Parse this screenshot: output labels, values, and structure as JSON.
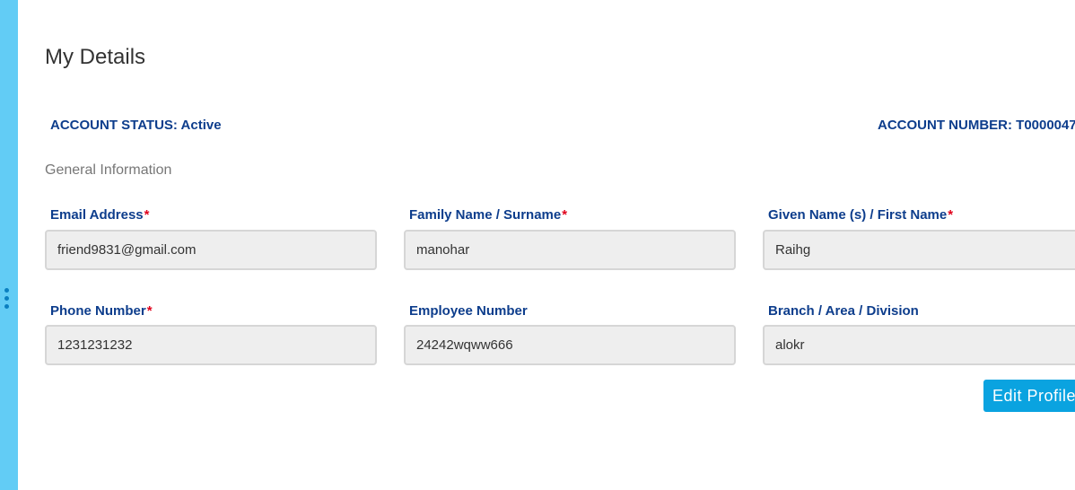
{
  "page": {
    "title": "My Details"
  },
  "account": {
    "status_label": "ACCOUNT STATUS: Active",
    "number_label": "ACCOUNT NUMBER: T0000047"
  },
  "section": {
    "title": "General Information"
  },
  "fields": {
    "email": {
      "label": "Email Address",
      "required": "*",
      "value": "friend9831@gmail.com"
    },
    "family_name": {
      "label": "Family Name / Surname",
      "required": "*",
      "value": "manohar"
    },
    "given_name": {
      "label": "Given Name (s) / First Name",
      "required": "*",
      "value": "Raihg"
    },
    "phone": {
      "label": "Phone Number",
      "required": "*",
      "value": "1231231232"
    },
    "employee_number": {
      "label": "Employee Number",
      "value": "24242wqww666"
    },
    "branch": {
      "label": "Branch / Area / Division",
      "value": "alokr"
    }
  },
  "actions": {
    "edit_label": "Edit Profile"
  },
  "icons": {
    "side_handle": "vertical-ellipsis-icon"
  },
  "colors": {
    "side_strip": "#62ccf5",
    "label_blue": "#0d3d8c",
    "required_red": "#e0001b",
    "button_blue": "#0aa3e0"
  }
}
